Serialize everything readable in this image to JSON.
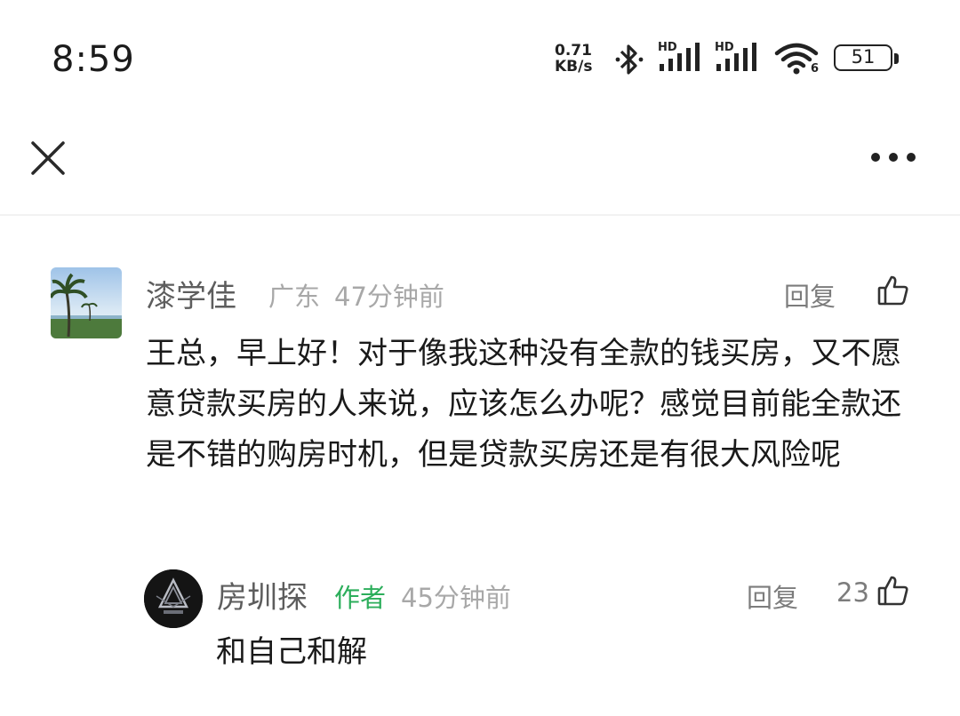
{
  "status_bar": {
    "time": "8:59",
    "net_speed_value": "0.71",
    "net_speed_unit": "KB/s",
    "signal1_label": "HD",
    "signal2_label": "HD",
    "wifi_label": "6",
    "battery": "51"
  },
  "comment": {
    "user": "漆学佳",
    "location": "广东",
    "time": "47分钟前",
    "reply_label": "回复",
    "text": "王总，早上好！对于像我这种没有全款的钱买房，又不愿意贷款买房的人来说，应该怎么办呢？感觉目前能全款还是不错的购房时机，但是贷款买房还是有很大风险呢"
  },
  "reply": {
    "user": "房圳探",
    "author_tag": "作者",
    "time": "45分钟前",
    "reply_label": "回复",
    "likes": "23",
    "text": "和自己和解"
  },
  "colors": {
    "author_tag": "#2cae5b",
    "name": "#5d5d5d",
    "meta": "#a8a8a8"
  }
}
